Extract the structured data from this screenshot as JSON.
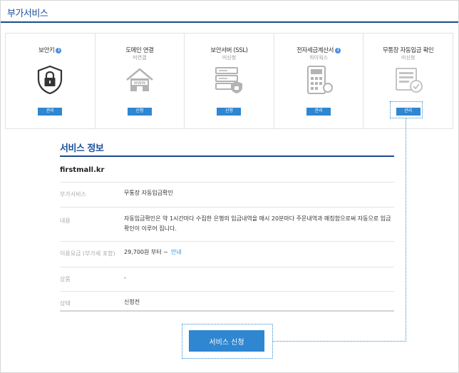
{
  "page": {
    "title": "부가서비스"
  },
  "cards": [
    {
      "title": "보안키",
      "has_info": true,
      "subtitle": "",
      "icon": "lock-shield-icon",
      "button": "관리"
    },
    {
      "title": "도메인 연결",
      "has_info": false,
      "subtitle": "미연결",
      "icon": "www-house-icon",
      "button": "신청"
    },
    {
      "title": "보안서버 (SSL)",
      "has_info": false,
      "subtitle": "미신청",
      "icon": "server-shield-icon",
      "button": "신청"
    },
    {
      "title": "전자세금계산서",
      "has_info": true,
      "subtitle": "하이웍스",
      "icon": "calculator-icon",
      "button": "관리"
    },
    {
      "title": "무통장 자동입금 확인",
      "has_info": false,
      "subtitle": "미신청",
      "icon": "receipt-check-icon",
      "button": "관리"
    }
  ],
  "info_glyph": "i",
  "service_info": {
    "title": "서비스 정보",
    "domain": "firstmall.kr",
    "rows": [
      {
        "label": "부가서비스",
        "value": "무통장 자동입금확인"
      },
      {
        "label": "내용",
        "value": "자동입금확인은 약 1시간마다 수집한 은행의 입금내역을 매시 20분마다 주문내역과 매칭함으로써 자동으로 입금확인이 이루어 집니다."
      },
      {
        "label": "이용요금 (부가세 포함)",
        "value": "29,700원 부터 ~",
        "link": "안내"
      },
      {
        "label": "상품",
        "value": "-"
      },
      {
        "label": "상태",
        "value": "신청전"
      }
    ]
  },
  "apply_button": "서비스 신청",
  "colors": {
    "accent": "#1e4b8e",
    "button": "#2f86d1",
    "icon": "#b3b3b3"
  }
}
